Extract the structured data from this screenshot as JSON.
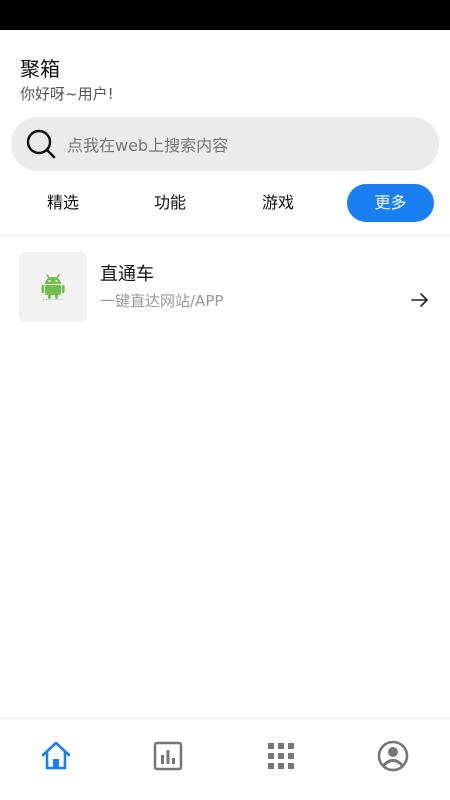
{
  "header": {
    "title": "聚箱",
    "greeting": "你好呀~用户!"
  },
  "search": {
    "placeholder": "点我在web上搜索内容"
  },
  "tabs": [
    {
      "label": "精选",
      "active": false
    },
    {
      "label": "功能",
      "active": false
    },
    {
      "label": "游戏",
      "active": false
    },
    {
      "label": "更多",
      "active": true
    }
  ],
  "list": [
    {
      "title": "直通车",
      "subtitle": "一键直达网站/APP",
      "icon": "android-icon"
    }
  ],
  "bottom_nav": [
    {
      "icon": "home-icon",
      "active": true
    },
    {
      "icon": "chart-icon",
      "active": false
    },
    {
      "icon": "grid-icon",
      "active": false
    },
    {
      "icon": "profile-icon",
      "active": false
    }
  ],
  "colors": {
    "accent": "#1a7ff2",
    "search_bg": "#ebebeb",
    "inactive_icon": "#777777",
    "android_green": "#6fbf4a"
  }
}
